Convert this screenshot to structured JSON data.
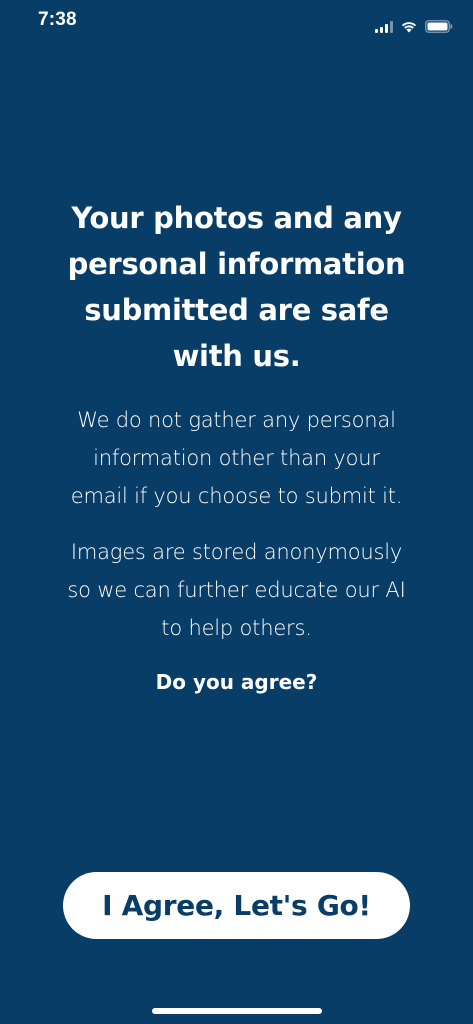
{
  "status_bar": {
    "time": "7:38",
    "icons": [
      "cellular-signal-icon",
      "wifi-icon",
      "battery-icon"
    ]
  },
  "consent": {
    "headline_lines": [
      "Your photos and any",
      "personal information",
      "submitted are safe",
      "with us."
    ],
    "paragraph_1_lines": [
      "We do not gather any personal",
      "information other than your",
      "email if you choose to submit it."
    ],
    "paragraph_2_lines": [
      "Images are stored anonymously",
      "so we can further educate our AI",
      "to help others."
    ],
    "question": "Do you agree?"
  },
  "actions": {
    "agree_label": "I Agree, Let's Go!"
  },
  "colors": {
    "background": "#073d67",
    "text": "#ffffff",
    "button_background": "#ffffff",
    "button_text": "#073d67"
  }
}
